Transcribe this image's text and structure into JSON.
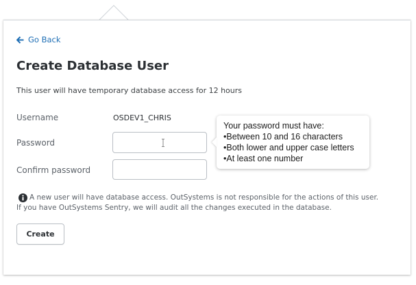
{
  "nav": {
    "back_label": "Go Back",
    "back_icon": "arrow-left-icon",
    "accent": "#1f6fb5"
  },
  "page": {
    "title": "Create Database User",
    "subtitle": "This user will have temporary database access for 12 hours"
  },
  "form": {
    "username_label": "Username",
    "username_value": "OSDEV1_CHRIS",
    "password_label": "Password",
    "password_value": "",
    "confirm_label": "Confirm password",
    "confirm_value": ""
  },
  "tooltip": {
    "heading": "Your password must have:",
    "rules": [
      "Between 10 and 16 characters",
      "Both lower and upper case letters",
      "At least one number"
    ]
  },
  "notice": {
    "icon": "info-icon",
    "line1": "A new user will have database access. OutSystems is not responsible for the actions of this user.",
    "line2": "If you have OutSystems Sentry, we will audit all the changes executed in the database."
  },
  "actions": {
    "create_label": "Create"
  }
}
